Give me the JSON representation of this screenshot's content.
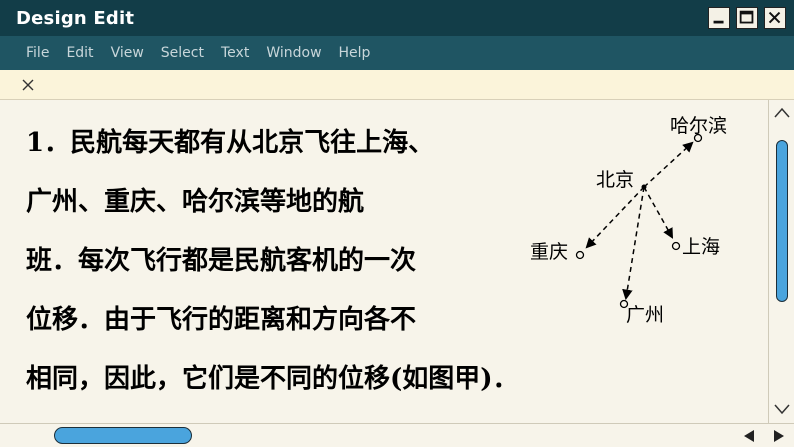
{
  "window": {
    "title": "Design Edit",
    "controls": [
      "minimize-icon",
      "maximize-icon",
      "close-icon"
    ]
  },
  "menu": {
    "items": [
      "File",
      "Edit",
      "View",
      "Select",
      "Text",
      "Window",
      "Help"
    ]
  },
  "tab": {
    "close_icon": "close-icon"
  },
  "content": {
    "lines": [
      "1．民航每天都有从北京飞往上海、",
      "广州、重庆、哈尔滨等地的航",
      "班．每次飞行都是民航客机的一次",
      "位移．由于飞行的距离和方向各不",
      "相同，因此，它们是不同的位移(如图甲)．"
    ]
  },
  "diagram": {
    "origin": "北京",
    "destinations": [
      "哈尔滨",
      "上海",
      "重庆",
      "广州"
    ]
  },
  "scrollbars": {
    "vertical_position": 0.0,
    "horizontal_position": 0.0
  },
  "colors": {
    "titlebar": "#123d48",
    "menubar": "#1f5563",
    "scroll_thumb": "#4aa4dd",
    "background": "#f7f4ea"
  }
}
